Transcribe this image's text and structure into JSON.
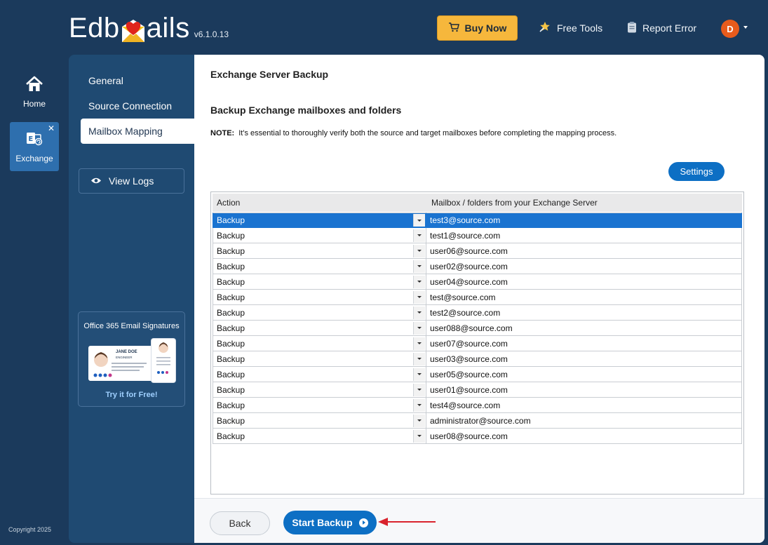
{
  "app": {
    "logo_text_before": "Edb",
    "logo_text_after": "ails",
    "version": "v6.1.0.13",
    "brand_color": "#0d6fc4",
    "background_color": "#1b3a5c"
  },
  "topbar": {
    "buy_now": "Buy Now",
    "free_tools": "Free Tools",
    "report_error": "Report Error",
    "avatar_initial": "D"
  },
  "rail": {
    "home": "Home",
    "exchange": "Exchange",
    "close_glyph": "✕",
    "copyright": "Copyright 2025"
  },
  "nav": {
    "items": [
      {
        "label": "General",
        "active": false
      },
      {
        "label": "Source Connection",
        "active": false
      },
      {
        "label": "Mailbox Mapping",
        "active": true
      }
    ],
    "view_logs": "View Logs",
    "promo": {
      "title": "Office 365 Email Signatures",
      "card_name": "JANE DOE",
      "card_role": "ENGINEER",
      "link": "Try it for Free!"
    }
  },
  "main": {
    "title": "Exchange Server Backup",
    "section_title": "Backup Exchange mailboxes and folders",
    "note_label": "NOTE:",
    "note_text": "It's essential to thoroughly verify both the source and target mailboxes before completing the mapping process.",
    "settings": "Settings",
    "grid": {
      "columns": [
        "Action",
        "Mailbox / folders from your Exchange Server"
      ],
      "rows": [
        {
          "action": "Backup",
          "mailbox": "test3@source.com",
          "selected": true
        },
        {
          "action": "Backup",
          "mailbox": "test1@source.com"
        },
        {
          "action": "Backup",
          "mailbox": "user06@source.com"
        },
        {
          "action": "Backup",
          "mailbox": "user02@source.com"
        },
        {
          "action": "Backup",
          "mailbox": "user04@source.com"
        },
        {
          "action": "Backup",
          "mailbox": "test@source.com"
        },
        {
          "action": "Backup",
          "mailbox": "test2@source.com"
        },
        {
          "action": "Backup",
          "mailbox": "user088@source.com"
        },
        {
          "action": "Backup",
          "mailbox": "user07@source.com"
        },
        {
          "action": "Backup",
          "mailbox": "user03@source.com"
        },
        {
          "action": "Backup",
          "mailbox": "user05@source.com"
        },
        {
          "action": "Backup",
          "mailbox": "user01@source.com"
        },
        {
          "action": "Backup",
          "mailbox": "test4@source.com"
        },
        {
          "action": "Backup",
          "mailbox": "administrator@source.com"
        },
        {
          "action": "Backup",
          "mailbox": "user08@source.com"
        }
      ]
    },
    "back": "Back",
    "start_backup": "Start Backup"
  }
}
